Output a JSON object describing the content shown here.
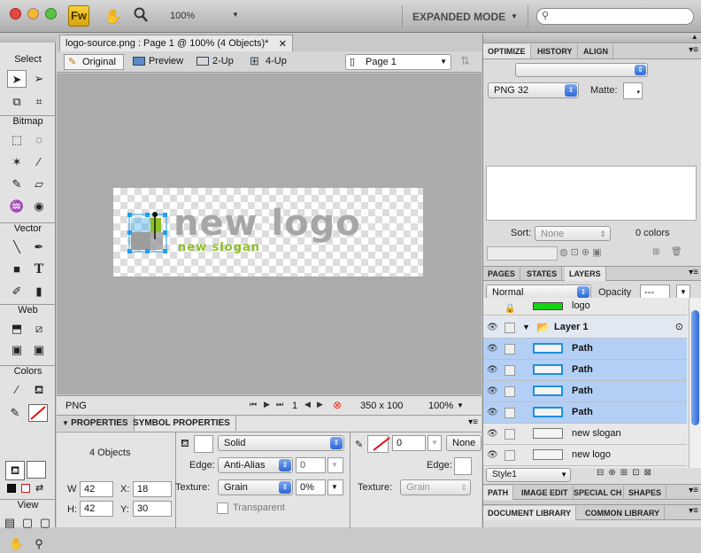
{
  "titlebar": {
    "zoom": "100%",
    "mode": "EXPANDED MODE",
    "app_icon": "Fw",
    "search_placeholder": ""
  },
  "toolbar": {
    "sections": [
      "Select",
      "Bitmap",
      "Vector",
      "Web",
      "Colors",
      "View"
    ]
  },
  "document": {
    "tab_title": "logo-source.png : Page 1 @ 100% (4 Objects)*",
    "views": [
      "Original",
      "Preview",
      "2-Up",
      "4-Up"
    ],
    "page_select": "Page 1",
    "logo_text": "new logo",
    "slogan_text": "new slogan",
    "brand_colors": {
      "green": "#8cbf26",
      "blue": "#1ea0ee",
      "gray": "#9c9c9c"
    }
  },
  "status": {
    "format": "PNG",
    "page_index": "1",
    "dimensions": "350 x 100",
    "zoom": "100%"
  },
  "properties": {
    "tabs": [
      "PROPERTIES",
      "SYMBOL PROPERTIES"
    ],
    "object_count": "4 Objects",
    "fill_type": "Solid",
    "edge_label": "Edge:",
    "edge_value": "Anti-Alias",
    "edge_amount": "0",
    "texture_label": "Texture:",
    "texture_value": "Grain",
    "texture_amount": "0%",
    "transparent_label": "Transparent",
    "w_label": "W",
    "w": "42",
    "h_label": "H:",
    "h": "42",
    "x_label": "X:",
    "x": "18",
    "y_label": "Y:",
    "y": "30",
    "stroke_size": "0",
    "stroke_type": "None",
    "edge_label_2": "Edge:",
    "texture_label_2": "Texture:",
    "texture_value_2": "Grain"
  },
  "optimize": {
    "tabs": [
      "OPTIMIZE",
      "HISTORY",
      "ALIGN"
    ],
    "format": "PNG 32",
    "matte_label": "Matte:",
    "sort_label": "Sort:",
    "sort_value": "None",
    "colors_count": "0 colors"
  },
  "layers": {
    "tabs": [
      "PAGES",
      "STATES",
      "LAYERS"
    ],
    "blend": "Normal",
    "opacity_label": "Opacity",
    "opacity_value": "---",
    "rows": [
      {
        "name": "logo",
        "type": "web"
      },
      {
        "name": "Layer 1",
        "type": "layer"
      },
      {
        "name": "Path",
        "type": "path-selected"
      },
      {
        "name": "Path",
        "type": "path-selected"
      },
      {
        "name": "Path",
        "type": "path-selected"
      },
      {
        "name": "Path",
        "type": "path-selected"
      },
      {
        "name": "new slogan",
        "type": "object"
      },
      {
        "name": "new logo",
        "type": "object"
      }
    ],
    "style_select": "Style1"
  },
  "bottom_tabs": [
    "PATH",
    "IMAGE EDIT",
    "SPECIAL CH",
    "SHAPES"
  ],
  "library_tabs": [
    "DOCUMENT LIBRARY",
    "COMMON LIBRARY"
  ]
}
